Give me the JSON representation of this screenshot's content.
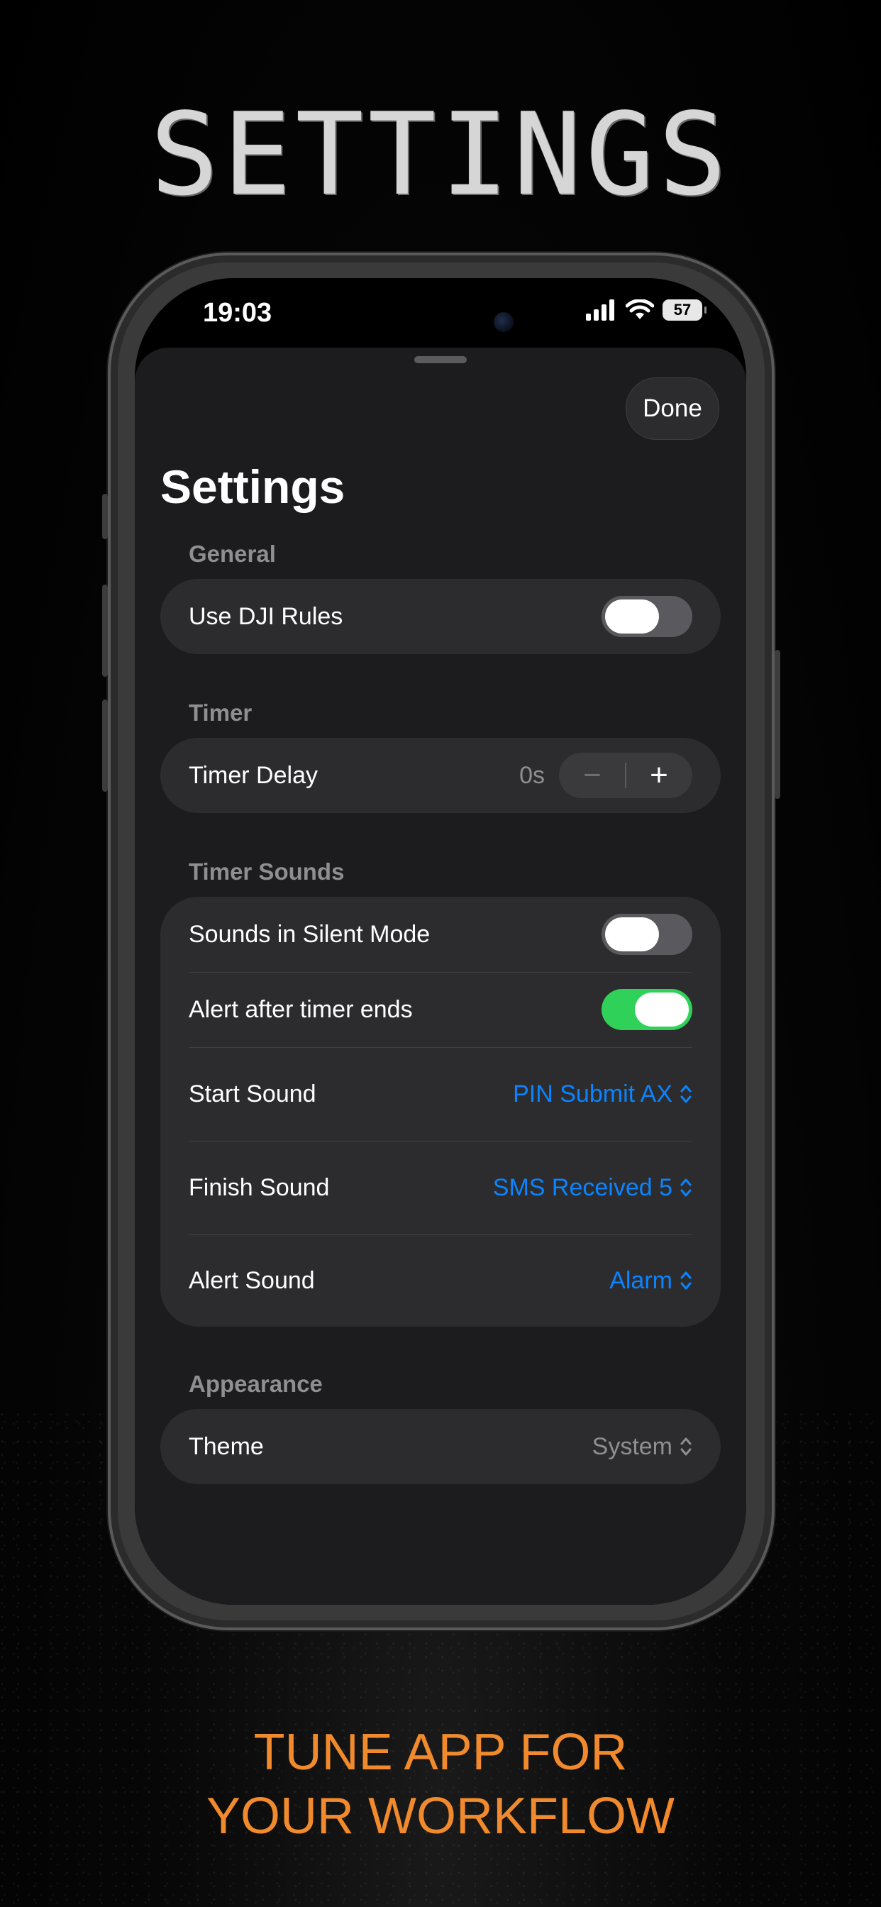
{
  "marketing": {
    "headline": "SETTINGS",
    "tagline_line1": "TUNE APP FOR",
    "tagline_line2": "YOUR WORKFLOW",
    "accent_color": "#f08a2c"
  },
  "status_bar": {
    "time": "19:03",
    "battery": "57",
    "icons": [
      "cellular-signal-icon",
      "wifi-icon",
      "battery-icon"
    ]
  },
  "sheet": {
    "done_label": "Done",
    "title": "Settings"
  },
  "sections": {
    "general": {
      "label": "General",
      "use_dji_rules": {
        "label": "Use DJI Rules",
        "on": false
      }
    },
    "timer": {
      "label": "Timer",
      "timer_delay": {
        "label": "Timer Delay",
        "value": "0s",
        "minus": "−",
        "plus": "+"
      }
    },
    "timer_sounds": {
      "label": "Timer Sounds",
      "silent_mode": {
        "label": "Sounds in Silent Mode",
        "on": false
      },
      "alert_after": {
        "label": "Alert after timer ends",
        "on": true
      },
      "start_sound": {
        "label": "Start Sound",
        "value": "PIN Submit AX"
      },
      "finish_sound": {
        "label": "Finish Sound",
        "value": "SMS Received 5"
      },
      "alert_sound": {
        "label": "Alert Sound",
        "value": "Alarm"
      }
    },
    "appearance": {
      "label": "Appearance",
      "theme": {
        "label": "Theme",
        "value": "System"
      }
    }
  },
  "colors": {
    "toggle_on": "#30d158",
    "link_blue": "#0a84ff",
    "secondary_text": "#8e8e93"
  }
}
